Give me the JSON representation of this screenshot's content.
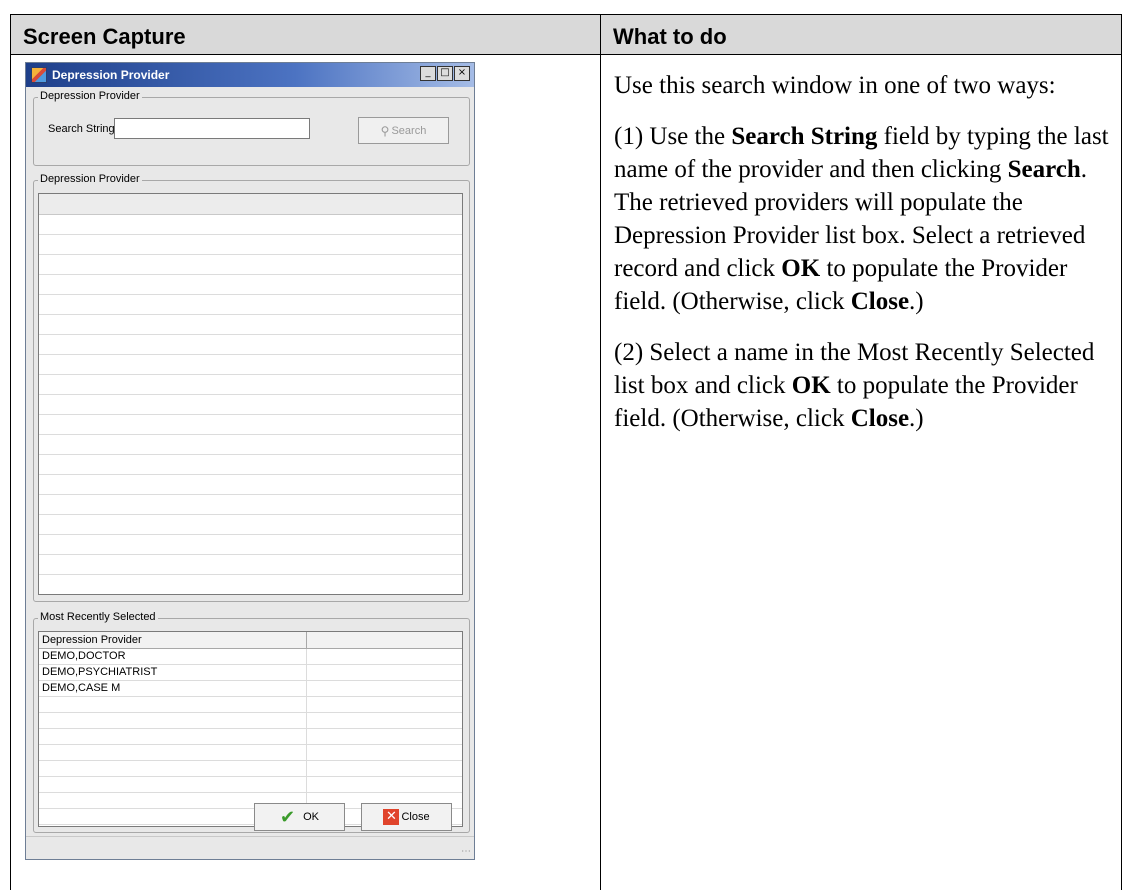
{
  "table": {
    "header_left": "Screen Capture",
    "header_right": "What to do"
  },
  "dialog": {
    "title": "Depression Provider",
    "win_buttons": [
      "_",
      "□",
      "×"
    ],
    "search_group": {
      "label": "Depression Provider",
      "search_label": "Search String",
      "search_value": "",
      "search_button": "Search"
    },
    "results_group": {
      "label": "Depression Provider",
      "rows": []
    },
    "recent_group": {
      "label": "Most Recently Selected",
      "column_header": "Depression Provider",
      "rows": [
        "DEMO,DOCTOR",
        "DEMO,PSYCHIATRIST",
        "DEMO,CASE M"
      ]
    },
    "ok_button": "OK",
    "close_button": "Close"
  },
  "instructions": {
    "p1": "Use this search window in one of two ways:",
    "p2_a": "(1) Use the ",
    "p2_b": "Search String",
    "p2_c": " field by typing the last name of the provider and then clicking ",
    "p2_d": "Search",
    "p2_e": ". The retrieved providers will populate the Depression Provider list box. Select a retrieved record and click ",
    "p2_f": "OK",
    "p2_g": " to populate the Provider field. (Otherwise, click ",
    "p2_h": "Close",
    "p2_i": ".)",
    "p3_a": "(2) Select a name in the Most Recently Selected list box and click ",
    "p3_b": "OK",
    "p3_c": " to populate the Provider field. (Otherwise, click ",
    "p3_d": "Close",
    "p3_e": ".)"
  }
}
